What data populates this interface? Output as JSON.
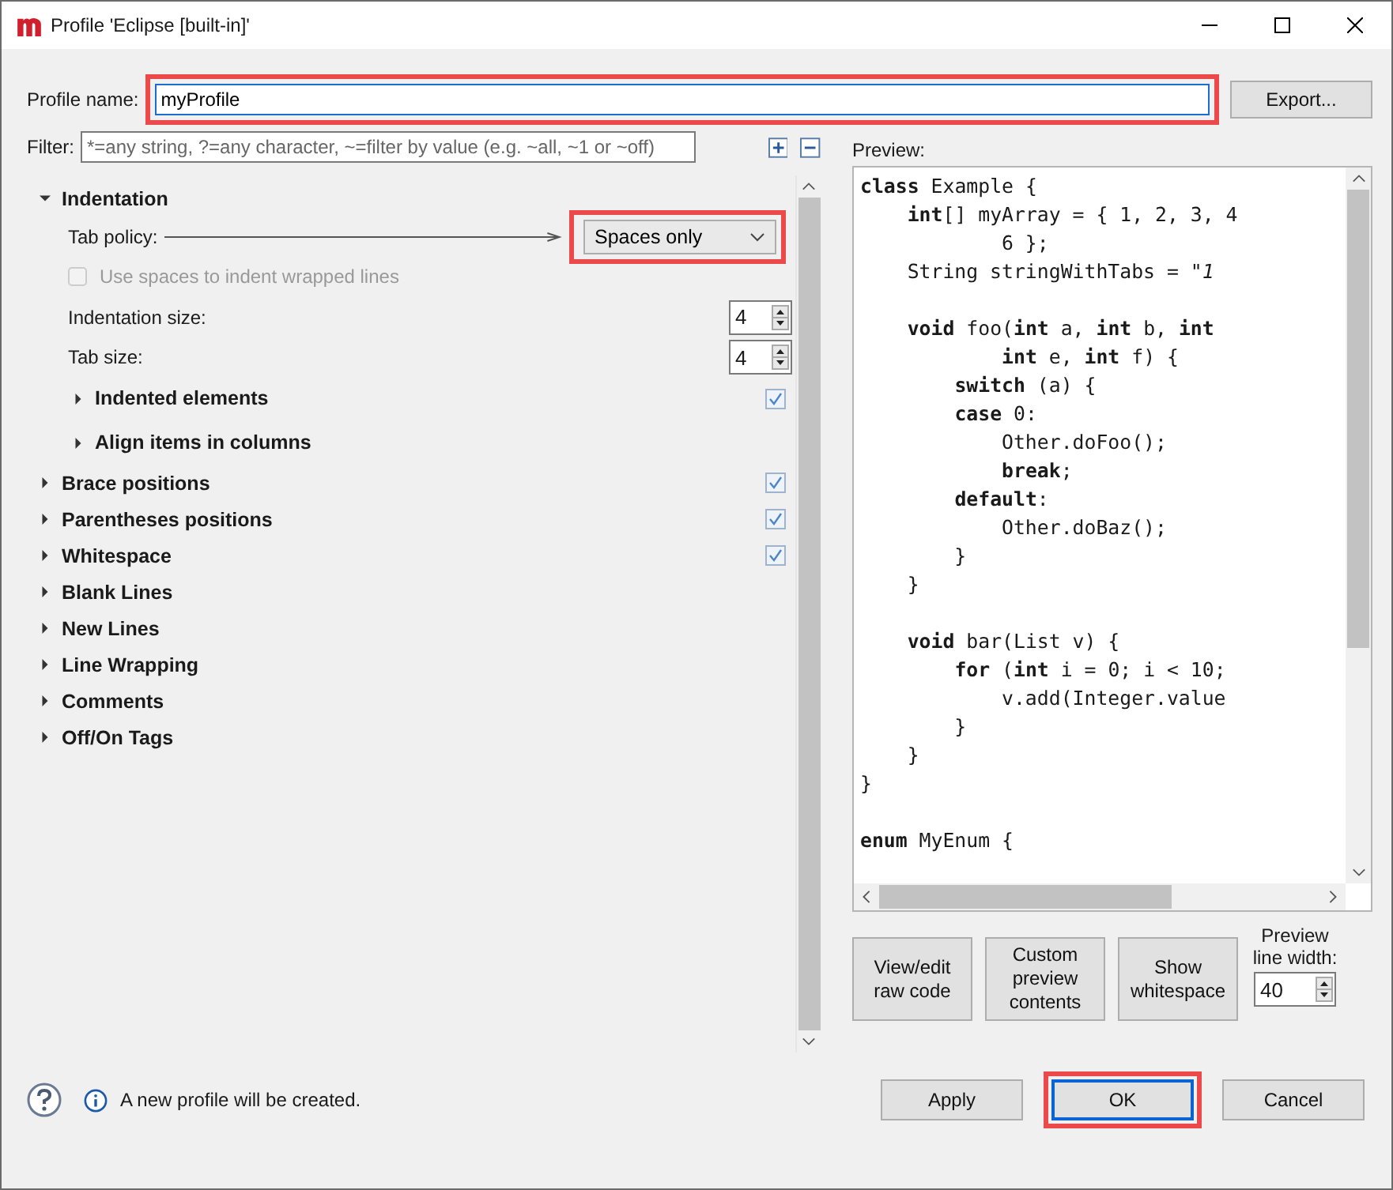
{
  "window": {
    "title": "Profile 'Eclipse [built-in]'"
  },
  "profile_name": {
    "label": "Profile name:",
    "value": "myProfile",
    "highlighted": true
  },
  "export_button": "Export...",
  "filter": {
    "label": "Filter:",
    "placeholder": "*=any string, ?=any character, ~=filter by value (e.g. ~all, ~1 or ~off)"
  },
  "tree": [
    {
      "label": "Indentation",
      "expanded": true,
      "children": [
        {
          "kind": "dropdown",
          "label": "Tab policy:",
          "value": "Spaces only",
          "highlighted": true
        },
        {
          "kind": "checkbox",
          "label": "Use spaces to indent wrapped lines",
          "checked": false,
          "disabled": true
        },
        {
          "kind": "spinner",
          "label": "Indentation size:",
          "value": "4"
        },
        {
          "kind": "spinner",
          "label": "Tab size:",
          "value": "4"
        },
        {
          "kind": "section",
          "label": "Indented elements",
          "expanded": false,
          "checked": true
        },
        {
          "kind": "section",
          "label": "Align items in columns",
          "expanded": false
        }
      ]
    },
    {
      "label": "Brace positions",
      "expanded": false,
      "checked": true
    },
    {
      "label": "Parentheses positions",
      "expanded": false,
      "checked": true
    },
    {
      "label": "Whitespace",
      "expanded": false,
      "checked": true
    },
    {
      "label": "Blank Lines",
      "expanded": false
    },
    {
      "label": "New Lines",
      "expanded": false
    },
    {
      "label": "Line Wrapping",
      "expanded": false
    },
    {
      "label": "Comments",
      "expanded": false
    },
    {
      "label": "Off/On Tags",
      "expanded": false
    }
  ],
  "preview": {
    "label": "Preview:",
    "code": [
      {
        "kind": "code",
        "text": "**class** Example {"
      },
      {
        "kind": "code",
        "text": "    **int**[] myArray = { 1, 2, 3, 4"
      },
      {
        "kind": "code",
        "text": "            6 };"
      },
      {
        "kind": "code",
        "text": "    String stringWithTabs = *\"1*"
      },
      {
        "kind": "blank"
      },
      {
        "kind": "code",
        "text": "    **void** foo(**int** a, **int** b, **int**"
      },
      {
        "kind": "code",
        "text": "            **int** e, **int** f) {"
      },
      {
        "kind": "code",
        "text": "        **switch** (a) {"
      },
      {
        "kind": "code",
        "text": "        **case** 0:"
      },
      {
        "kind": "code",
        "text": "            Other.doFoo();"
      },
      {
        "kind": "code",
        "text": "            **break**;"
      },
      {
        "kind": "code",
        "text": "        **default**:"
      },
      {
        "kind": "code",
        "text": "            Other.doBaz();"
      },
      {
        "kind": "code",
        "text": "        }"
      },
      {
        "kind": "code",
        "text": "    }"
      },
      {
        "kind": "blank"
      },
      {
        "kind": "code",
        "text": "    **void** bar(List v) {"
      },
      {
        "kind": "code",
        "text": "        **for** (**int** i = 0; i < 10;"
      },
      {
        "kind": "code",
        "text": "            v.add(Integer.value"
      },
      {
        "kind": "code",
        "text": "        }"
      },
      {
        "kind": "code",
        "text": "    }"
      },
      {
        "kind": "code",
        "text": "}"
      },
      {
        "kind": "blank"
      },
      {
        "kind": "code",
        "text": "**enum** MyEnum {"
      }
    ]
  },
  "preview_buttons": [
    "View/edit raw code",
    "Custom preview contents",
    "Show whitespace"
  ],
  "line_width": {
    "label": "Preview line width:",
    "value": "40"
  },
  "status": "A new profile will be created.",
  "buttons": [
    {
      "label": "Apply",
      "default": false,
      "highlighted": false
    },
    {
      "label": "OK",
      "default": true,
      "highlighted": true
    },
    {
      "label": "Cancel",
      "default": false,
      "highlighted": false
    }
  ]
}
